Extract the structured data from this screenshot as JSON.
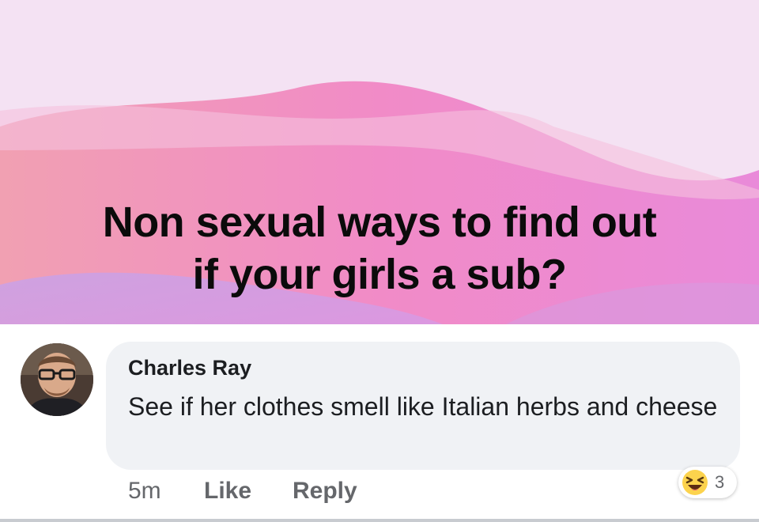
{
  "post": {
    "text_line1": "Non sexual ways to find out",
    "text_line2": "if your girls a sub?",
    "background_colors": [
      "#f3dff2",
      "#ee9fd0",
      "#e58bd6",
      "#b99ae6"
    ]
  },
  "comment": {
    "author": "Charles Ray",
    "text": "See if her clothes smell like Italian herbs and cheese",
    "time": "5m",
    "like_label": "Like",
    "reply_label": "Reply",
    "reaction": {
      "icon": "haha-emoji-icon",
      "count": "3"
    }
  },
  "colors": {
    "bubble": "#f0f2f5",
    "meta": "#65676b",
    "text": "#1c1e21"
  }
}
